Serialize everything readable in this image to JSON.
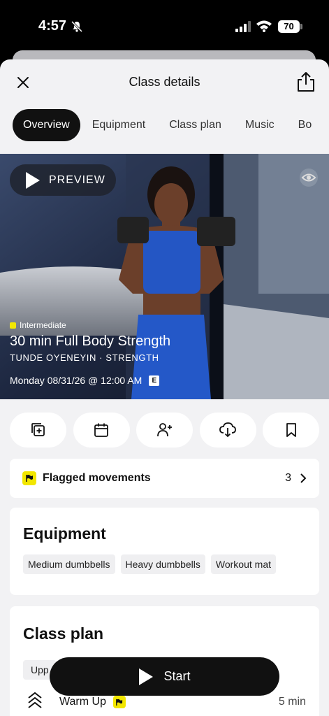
{
  "status_bar": {
    "time": "4:57",
    "battery": "70"
  },
  "header": {
    "title": "Class details"
  },
  "tabs": [
    {
      "label": "Overview",
      "active": true
    },
    {
      "label": "Equipment"
    },
    {
      "label": "Class plan"
    },
    {
      "label": "Music"
    },
    {
      "label": "Bo"
    }
  ],
  "hero": {
    "preview_label": "PREVIEW",
    "level": "Intermediate",
    "title": "30 min Full Body Strength",
    "instructor": "TUNDE OYENEYIN · STRENGTH",
    "datetime": "Monday 08/31/26 @ 12:00 AM",
    "explicit_badge": "E"
  },
  "actions": [
    {
      "icon": "add-to-stack-icon"
    },
    {
      "icon": "calendar-icon"
    },
    {
      "icon": "invite-friends-icon"
    },
    {
      "icon": "download-icon"
    },
    {
      "icon": "bookmark-icon"
    }
  ],
  "flagged": {
    "label": "Flagged movements",
    "count": "3"
  },
  "equipment": {
    "title": "Equipment",
    "items": [
      "Medium dumbbells",
      "Heavy dumbbells",
      "Workout mat"
    ]
  },
  "class_plan": {
    "title": "Class plan",
    "chip": "Upp",
    "first_item": {
      "name": "Warm Up",
      "duration": "5 min"
    }
  },
  "start_button": {
    "label": "Start"
  },
  "colors": {
    "accent_yellow": "#f2e600",
    "dark": "#111111",
    "sheet_bg": "#f2f2f4"
  }
}
